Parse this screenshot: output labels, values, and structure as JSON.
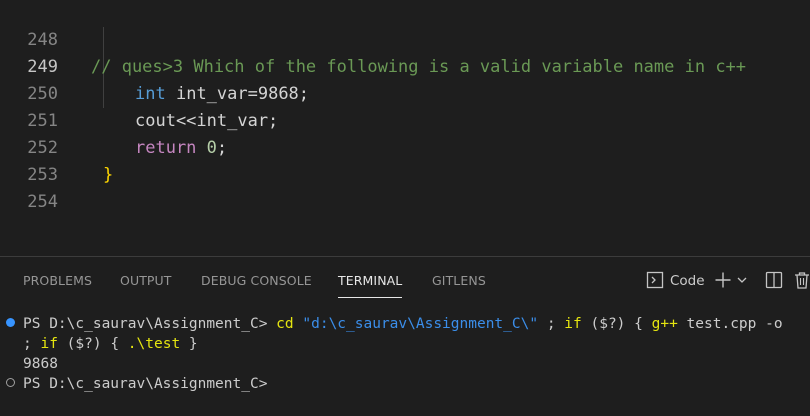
{
  "editor": {
    "lines": [
      {
        "number": "248",
        "text": "// ques>3 Which of the following is a valid variable name in c++"
      },
      {
        "number": "249",
        "keyword": "int",
        "rest": "int_var=9868;"
      },
      {
        "number": "250",
        "text": "cout<<int_var;"
      },
      {
        "number": "251",
        "keyword": "return",
        "value": "0",
        "end": ";"
      },
      {
        "number": "252",
        "text": "}"
      },
      {
        "number": "253",
        "text": ""
      },
      {
        "number": "254",
        "text": ""
      }
    ]
  },
  "panel": {
    "tabs": [
      "PROBLEMS",
      "OUTPUT",
      "DEBUG CONSOLE",
      "TERMINAL",
      "GITLENS"
    ],
    "active_tab": "TERMINAL",
    "terminal_profile": "Code",
    "icons": [
      "terminal-icon",
      "plus-icon",
      "chevron-down-icon",
      "split-icon",
      "trash-icon"
    ]
  },
  "terminal": {
    "prompt": "PS D:\\c_saurav\\Assignment_C>",
    "cmd_cd": "cd",
    "cmd_path": "\"d:\\c_saurav\\Assignment_C\\\"",
    "cmd_sep": ";",
    "cmd_if": "if",
    "cmd_status": "($?)",
    "cmd_open": "{",
    "cmd_gpp": "g++",
    "cmd_args": "test.cpp -o",
    "cmd2_sep": ";",
    "cmd2_if": "if",
    "cmd2_status": "($?)",
    "cmd2_open": "{",
    "cmd2_run": ".\\test",
    "cmd2_close": "}",
    "output": "9868",
    "prompt2": "PS D:\\c_saurav\\Assignment_C>"
  }
}
